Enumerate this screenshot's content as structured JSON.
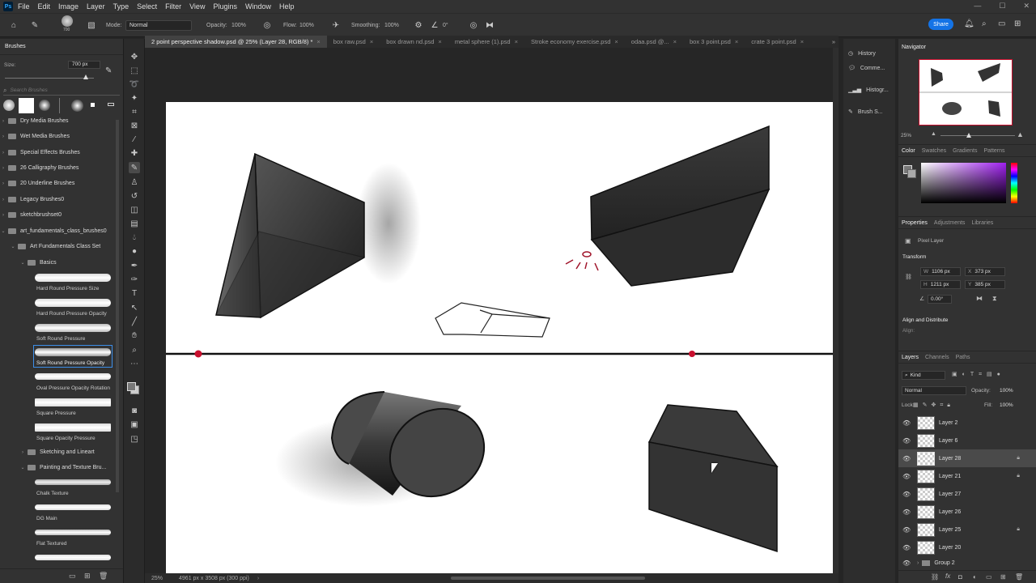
{
  "app": {
    "logo": "Ps"
  },
  "menu": [
    "File",
    "Edit",
    "Image",
    "Layer",
    "Type",
    "Select",
    "Filter",
    "View",
    "Plugins",
    "Window",
    "Help"
  ],
  "options": {
    "size_preview": "700",
    "mode_label": "Mode:",
    "mode_value": "Normal",
    "opacity_label": "Opacity:",
    "opacity_value": "100%",
    "flow_label": "Flow:",
    "flow_value": "100%",
    "smoothing_label": "Smoothing:",
    "smoothing_value": "100%",
    "angle_value": "0°",
    "share_label": "Share"
  },
  "brushes": {
    "title": "Brushes",
    "size_label": "Size:",
    "size_value": "700 px",
    "search_placeholder": "Search Brushes",
    "folders": [
      "Dry Media Brushes",
      "Wet Media Brushes",
      "Special Effects Brushes",
      "26 Calligraphy Brushes",
      "20 Underline Brushes",
      "Legacy Brushes0",
      "sketchbrushset0",
      "art_fundamentals_class_brushes0",
      "Art Fundamentals Class Set",
      "Basics"
    ],
    "items": [
      "Hard Round Pressure Size",
      "Hard Round Pressure Opacity",
      "Soft Round Pressure",
      "Soft Round Pressure Opacity",
      "Oval Pressure Opacity Rotation",
      "Square Pressure",
      "Square Opacity Pressure"
    ],
    "subfolders": [
      "Sketching and Lineart",
      "Painting and Texture Bru..."
    ],
    "items2": [
      "Chalk Texture",
      "DG Main",
      "Flat Textured"
    ]
  },
  "tabs": [
    {
      "label": "2 point perspective shadow.psd @ 25% (Layer 28, RGB/8) *",
      "active": true
    },
    {
      "label": "box raw.psd"
    },
    {
      "label": "box drawn nd.psd"
    },
    {
      "label": "metal sphere (1).psd"
    },
    {
      "label": "Stroke economy exercise.psd"
    },
    {
      "label": "odaa.psd @..."
    },
    {
      "label": "box 3 point.psd"
    },
    {
      "label": "crate 3 point.psd"
    }
  ],
  "status": {
    "zoom": "25%",
    "doc": "4961 px x 3508 px (300 ppi)"
  },
  "dock": [
    "History",
    "Comme...",
    "Histogr...",
    "Brush S..."
  ],
  "navigator": {
    "title": "Navigator",
    "zoom": "25%"
  },
  "color": {
    "tabs": [
      "Color",
      "Swatches",
      "Gradients",
      "Patterns"
    ]
  },
  "properties": {
    "tabs": [
      "Properties",
      "Adjustments",
      "Libraries"
    ],
    "kind": "Pixel Layer",
    "transform": "Transform",
    "w_label": "W",
    "w": "1106 px",
    "x_label": "X",
    "x": "373 px",
    "h_label": "H",
    "h": "1211 px",
    "y_label": "Y",
    "y": "385 px",
    "angle": "0.00°",
    "align": "Align and Distribute",
    "align_sub": "Align:"
  },
  "layers": {
    "tabs": [
      "Layers",
      "Channels",
      "Paths"
    ],
    "kind": "Kind",
    "blend": "Normal",
    "opacity_label": "Opacity:",
    "opacity": "100%",
    "lock_label": "Lock:",
    "fill_label": "Fill:",
    "fill": "100%",
    "list": [
      {
        "name": "Layer 2"
      },
      {
        "name": "Layer 6"
      },
      {
        "name": "Layer 28",
        "selected": true,
        "locked": true
      },
      {
        "name": "Layer 21",
        "locked": true
      },
      {
        "name": "Layer 27"
      },
      {
        "name": "Layer 26"
      },
      {
        "name": "Layer 25",
        "locked": true
      },
      {
        "name": "Layer 20"
      },
      {
        "name": "Group 2",
        "group": true
      }
    ]
  },
  "colors": {
    "accent": "#1473e6",
    "horizon_dot": "#c8102e"
  }
}
